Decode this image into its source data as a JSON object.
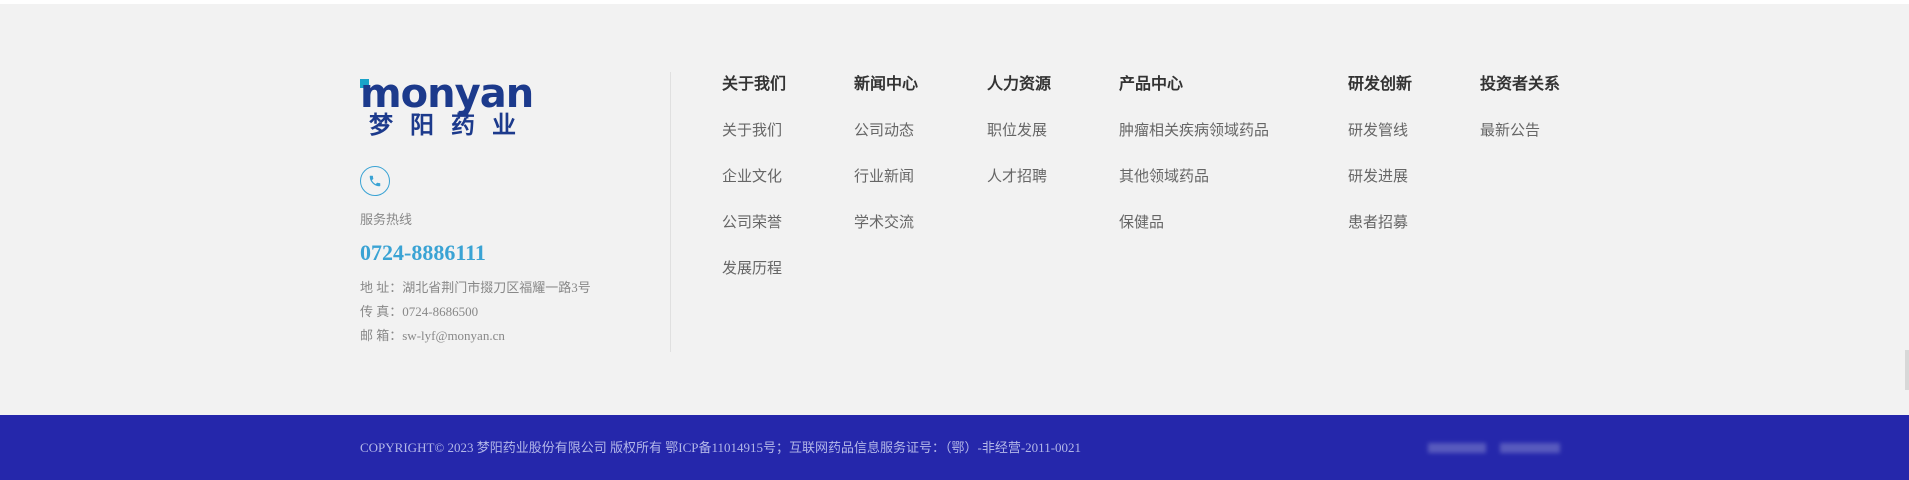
{
  "brand": {
    "logo_text": "monyan",
    "logo_cn": "梦阳药业",
    "colors": {
      "brand_blue": "#1c3a8c",
      "accent_cyan": "#19a3c9",
      "hotline": "#3aa3d4",
      "bar": "#2527ab"
    }
  },
  "contact": {
    "phone_icon": "phone-icon",
    "hotline_label": "服务热线",
    "hotline_number": "0724-8886111",
    "address": "地 址：湖北省荆门市掇刀区福耀一路3号",
    "fax": "传 真：0724-8686500",
    "email": "邮 箱：sw-lyf@monyan.cn"
  },
  "nav": [
    {
      "title": "关于我们",
      "items": [
        "关于我们",
        "企业文化",
        "公司荣誉",
        "发展历程"
      ]
    },
    {
      "title": "新闻中心",
      "items": [
        "公司动态",
        "行业新闻",
        "学术交流"
      ]
    },
    {
      "title": "人力资源",
      "items": [
        "职位发展",
        "人才招聘"
      ]
    },
    {
      "title": "产品中心",
      "items": [
        "肿瘤相关疾病领域药品",
        "其他领域药品",
        "保健品"
      ]
    },
    {
      "title": "研发创新",
      "items": [
        "研发管线",
        "研发进展",
        "患者招募"
      ]
    },
    {
      "title": "投资者关系",
      "items": [
        "最新公告"
      ]
    }
  ],
  "footer": {
    "copyright": "COPYRIGHT© 2023 梦阳药业股份有限公司 版权所有 鄂ICP备11014915号；互联网药品信息服务证号：（鄂）-非经营-2011-0021"
  }
}
